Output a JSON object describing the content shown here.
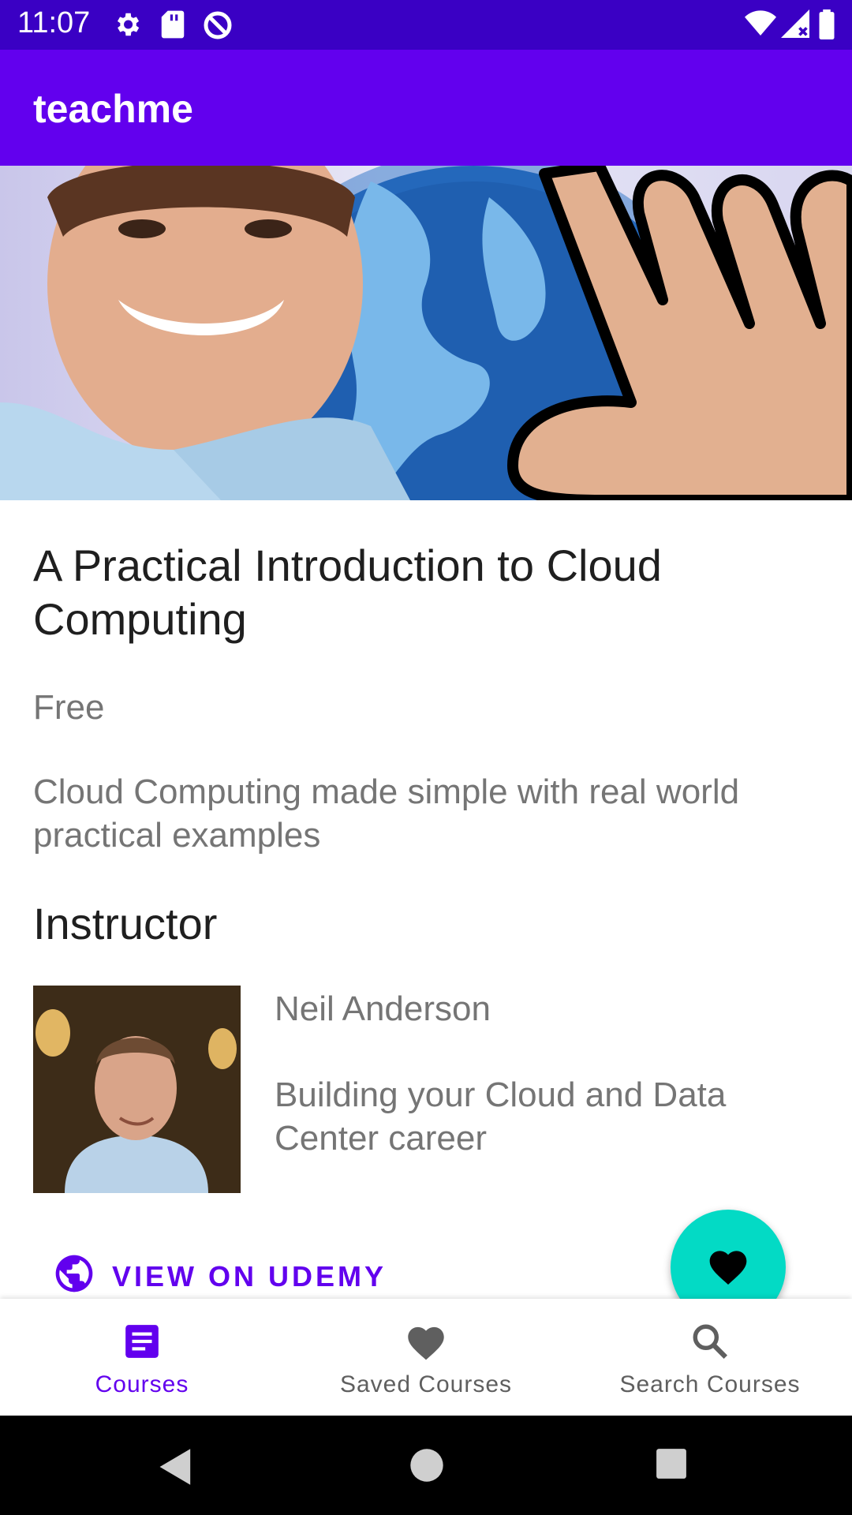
{
  "status_bar": {
    "time": "11:07",
    "left_icons": [
      "settings-gear-icon",
      "sd-card-icon",
      "at-sign-icon"
    ],
    "right_icons": [
      "wifi-icon",
      "cell-signal-icon",
      "battery-icon"
    ]
  },
  "app_bar": {
    "title": "teachme"
  },
  "course": {
    "title": "A Practical Introduction to Cloud Computing",
    "price": "Free",
    "description": "Cloud Computing made simple with real world practical examples"
  },
  "instructor": {
    "heading": "Instructor",
    "name": "Neil Anderson",
    "headline": "Building your Cloud and Data Center career"
  },
  "actions": {
    "view_on_udemy": "VIEW ON UDEMY",
    "fab_icon": "heart-icon"
  },
  "bottom_nav": {
    "items": [
      {
        "label": "Courses",
        "icon": "document-list-icon",
        "active": true
      },
      {
        "label": "Saved Courses",
        "icon": "heart-icon",
        "active": false
      },
      {
        "label": "Search Courses",
        "icon": "search-icon",
        "active": false
      }
    ]
  },
  "colors": {
    "status_bar": "#3a00c4",
    "primary": "#6200ee",
    "fab": "#03dac5",
    "text_secondary": "#757575"
  }
}
